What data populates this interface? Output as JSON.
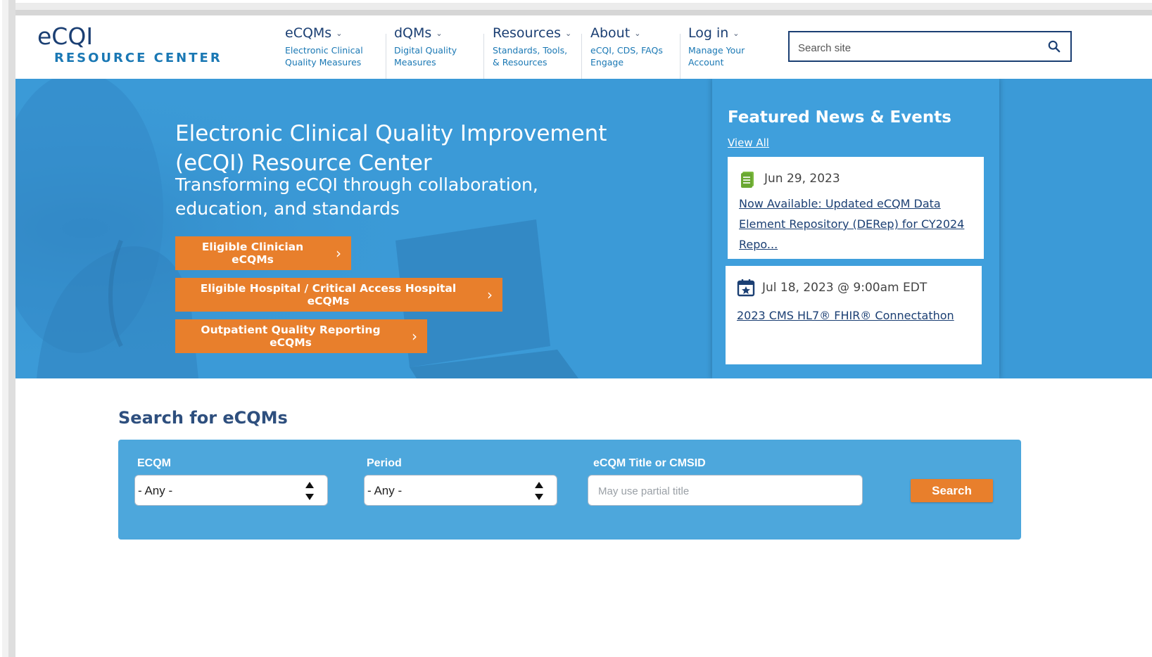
{
  "site": {
    "logo_top": "eCQI",
    "logo_bottom": "RESOURCE CENTER"
  },
  "nav": [
    {
      "title": "eCQMs",
      "sub": "Electronic Clinical Quality Measures"
    },
    {
      "title": "dQMs",
      "sub": "Digital Quality Measures"
    },
    {
      "title": "Resources",
      "sub": "Standards, Tools, & Resources"
    },
    {
      "title": "About",
      "sub": "eCQI, CDS, FAQs Engage"
    },
    {
      "title": "Log in",
      "sub": "Manage Your Account"
    }
  ],
  "site_search": {
    "placeholder": "Search site"
  },
  "hero": {
    "title": "Electronic Clinical Quality Improvement (eCQI) Resource Center",
    "subtitle": "Transforming eCQI through collaboration, education, and standards",
    "buttons": [
      {
        "label": "Eligible Clinician eCQMs"
      },
      {
        "label": "Eligible Hospital / Critical Access Hospital eCQMs"
      },
      {
        "label": "Outpatient Quality Reporting eCQMs"
      }
    ]
  },
  "news": {
    "heading": "Featured News & Events",
    "view_all": "View All",
    "items": [
      {
        "date": "Jun 29, 2023",
        "title": "Now Available: Updated eCQM Data Element Repository (DERep) for CY2024 Repo...",
        "icon": "document-icon"
      },
      {
        "date": "Jul 18, 2023 @ 9:00am EDT",
        "title": "2023 CMS HL7® FHIR® Connectathon",
        "icon": "calendar-icon"
      }
    ]
  },
  "ecqm_search": {
    "heading": "Search for eCQMs",
    "ecqm_label": "ECQM",
    "ecqm_value": "- Any -",
    "period_label": "Period",
    "period_value": "- Any -",
    "title_label": "eCQM Title or CMSID",
    "title_placeholder": "May use partial title",
    "button": "Search"
  },
  "colors": {
    "navy": "#1b3f73",
    "hero_blue": "#3b9ad7",
    "panel_blue": "#4da7dc",
    "orange": "#e87f2c"
  }
}
